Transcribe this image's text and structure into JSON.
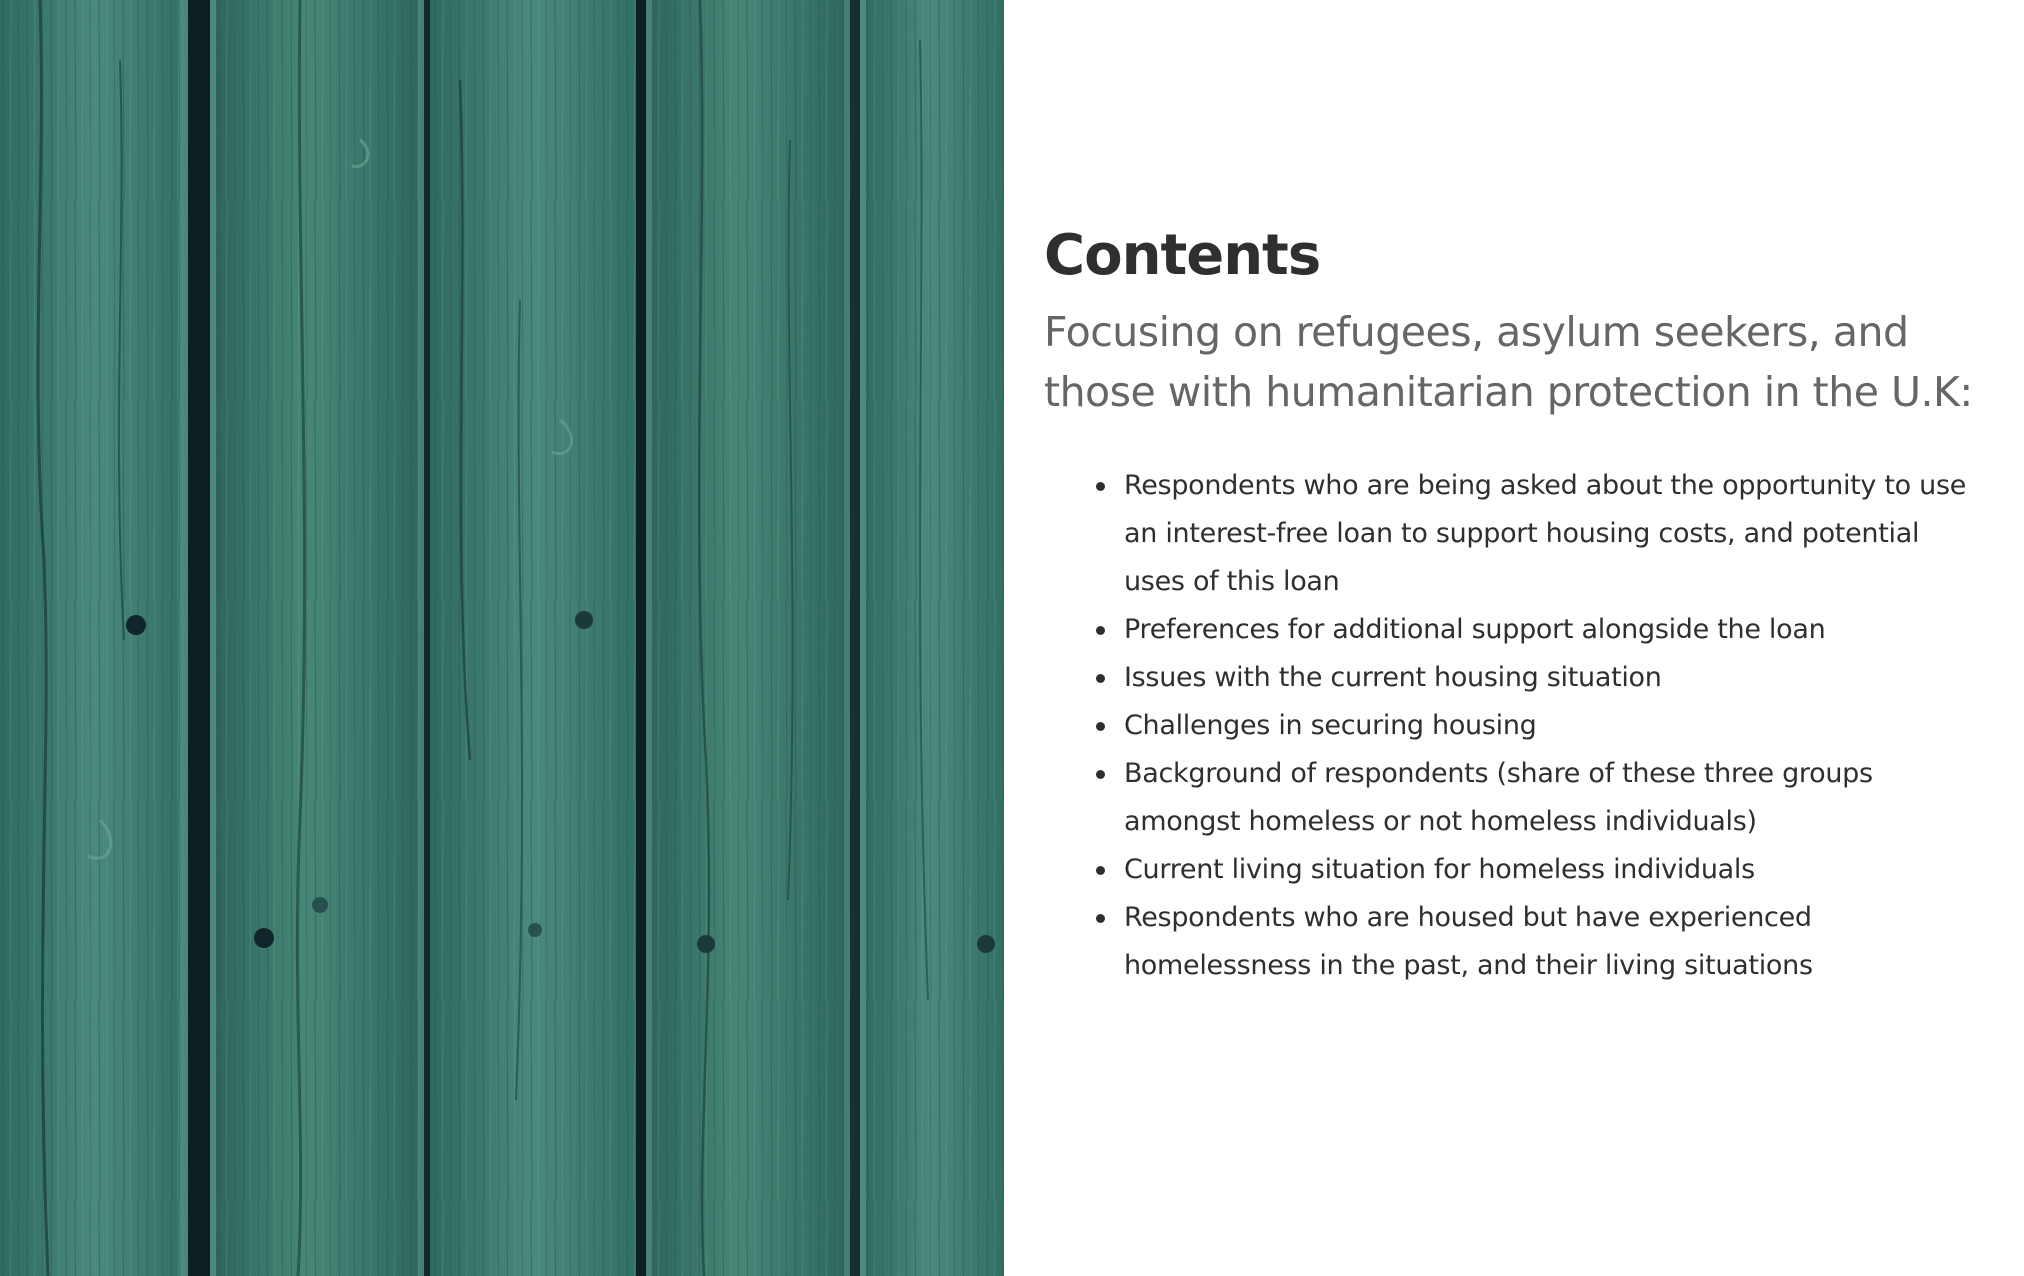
{
  "colors": {
    "plank_base": "#3f786c",
    "plank_dark": "#2a5b52",
    "plank_light": "#5e9c8d",
    "gap": "#0e1f24",
    "title": "#2f2f2f",
    "subtitle": "#666666",
    "body": "#2f2f2f"
  },
  "photo": {
    "icon": "wood-planks-photo"
  },
  "contents": {
    "title": "Contents",
    "subtitle": "Focusing on refugees, asylum seekers, and those with humanitarian protection in the U.K:",
    "items": [
      "Respondents who are being asked about the opportunity to use an interest-free loan to support housing costs, and potential uses of this loan",
      "Preferences for additional support alongside the loan",
      "Issues with the current housing situation",
      "Challenges in securing housing",
      "Background of respondents (share of these three groups amongst homeless or not homeless individuals)",
      "Current living situation for homeless individuals",
      "Respondents who are housed but have experienced homelessness in the past, and their living situations"
    ]
  }
}
